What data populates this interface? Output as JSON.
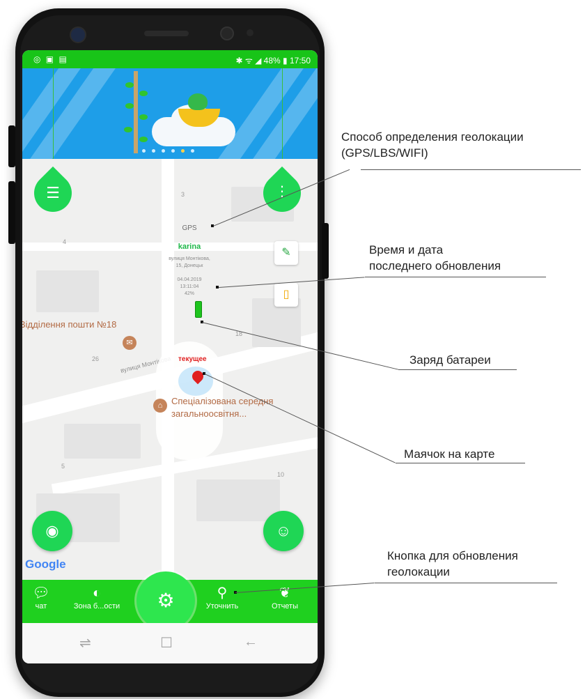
{
  "status_bar": {
    "left_icons": "◎ ▣ ▤",
    "right_text": "✱ ᯤ ◢ 48% ▮ 17:50"
  },
  "map": {
    "gps_label": "GPS",
    "device_name": "karina",
    "address_line1": "вулиця Монтікова,",
    "address_line2": "15, Донецьк",
    "date": "04.04.2019",
    "time": "13:11:04",
    "battery_percent": "42%",
    "marker_label": "текущее",
    "street_name": "вулиця Монтікова",
    "poi_post": "Відділення пошти №18",
    "poi_school_line1": "Спеціалізована середня",
    "poi_school_line2": "загальноосвітня...",
    "google_logo": "Google",
    "block_numbers": [
      "3",
      "4",
      "18",
      "26",
      "5",
      "10"
    ]
  },
  "nav": {
    "items": [
      {
        "label": "чат",
        "icon": "chat-icon"
      },
      {
        "label": "Зона б...ости",
        "icon": "safe-zone-icon"
      },
      {
        "label": "Уточнить",
        "icon": "location-pin-icon"
      },
      {
        "label": "Отчеты",
        "icon": "footprints-icon"
      }
    ],
    "center_icon": "gear-icon"
  },
  "annotations": {
    "geo_method_line1": "Способ определения геолокации",
    "geo_method_line2": "(GPS/LBS/WIFI)",
    "update_time_line1": "Время и дата",
    "update_time_line2": "последнего обновления",
    "battery": "Заряд батареи",
    "beacon": "Маячок на карте",
    "refresh_line1": "Кнопка для обновления",
    "refresh_line2": "геолокации"
  },
  "colors": {
    "accent": "#1fd655",
    "nav": "#1fd01f",
    "banner": "#1e9ee8",
    "marker": "#e02020"
  }
}
